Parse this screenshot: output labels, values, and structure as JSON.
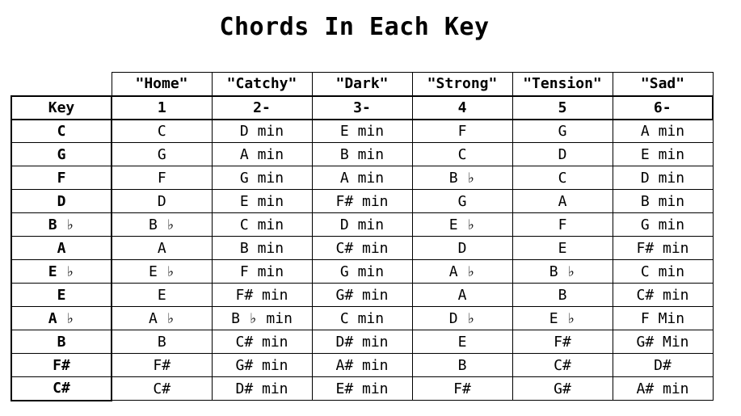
{
  "title": "Chords In Each Key",
  "labels": [
    "\"Home\"",
    "\"Catchy\"",
    "\"Dark\"",
    "\"Strong\"",
    "\"Tension\"",
    "\"Sad\""
  ],
  "header": {
    "key": "Key",
    "degrees": [
      "1",
      "2-",
      "3-",
      "4",
      "5",
      "6-"
    ]
  },
  "rows": [
    {
      "key": "C",
      "chords": [
        "C",
        "D min",
        "E min",
        "F",
        "G",
        "A min"
      ]
    },
    {
      "key": "G",
      "chords": [
        "G",
        "A min",
        "B min",
        "C",
        "D",
        "E min"
      ]
    },
    {
      "key": "F",
      "chords": [
        "F",
        "G min",
        "A min",
        "B ♭",
        "C",
        "D min"
      ]
    },
    {
      "key": "D",
      "chords": [
        "D",
        "E min",
        "F# min",
        "G",
        "A",
        "B min"
      ]
    },
    {
      "key": "B ♭",
      "chords": [
        "B ♭",
        "C min",
        "D min",
        "E ♭",
        "F",
        "G min"
      ]
    },
    {
      "key": "A",
      "chords": [
        "A",
        "B min",
        "C# min",
        "D",
        "E",
        "F# min"
      ]
    },
    {
      "key": "E ♭",
      "chords": [
        "E ♭",
        "F min",
        "G min",
        "A ♭",
        "B ♭",
        "C min"
      ]
    },
    {
      "key": "E",
      "chords": [
        "E",
        "F# min",
        "G# min",
        "A",
        "B",
        "C# min"
      ]
    },
    {
      "key": "A ♭",
      "chords": [
        "A ♭",
        "B ♭ min",
        "C min",
        "D ♭",
        "E ♭",
        "F Min"
      ]
    },
    {
      "key": "B",
      "chords": [
        "B",
        "C# min",
        "D# min",
        "E",
        "F#",
        "G# Min"
      ]
    },
    {
      "key": "F#",
      "chords": [
        "F#",
        "G# min",
        "A# min",
        "B",
        "C#",
        "D#"
      ]
    },
    {
      "key": "C#",
      "chords": [
        "C#",
        "D# min",
        "E# min",
        "F#",
        "G#",
        "A# min"
      ]
    }
  ]
}
